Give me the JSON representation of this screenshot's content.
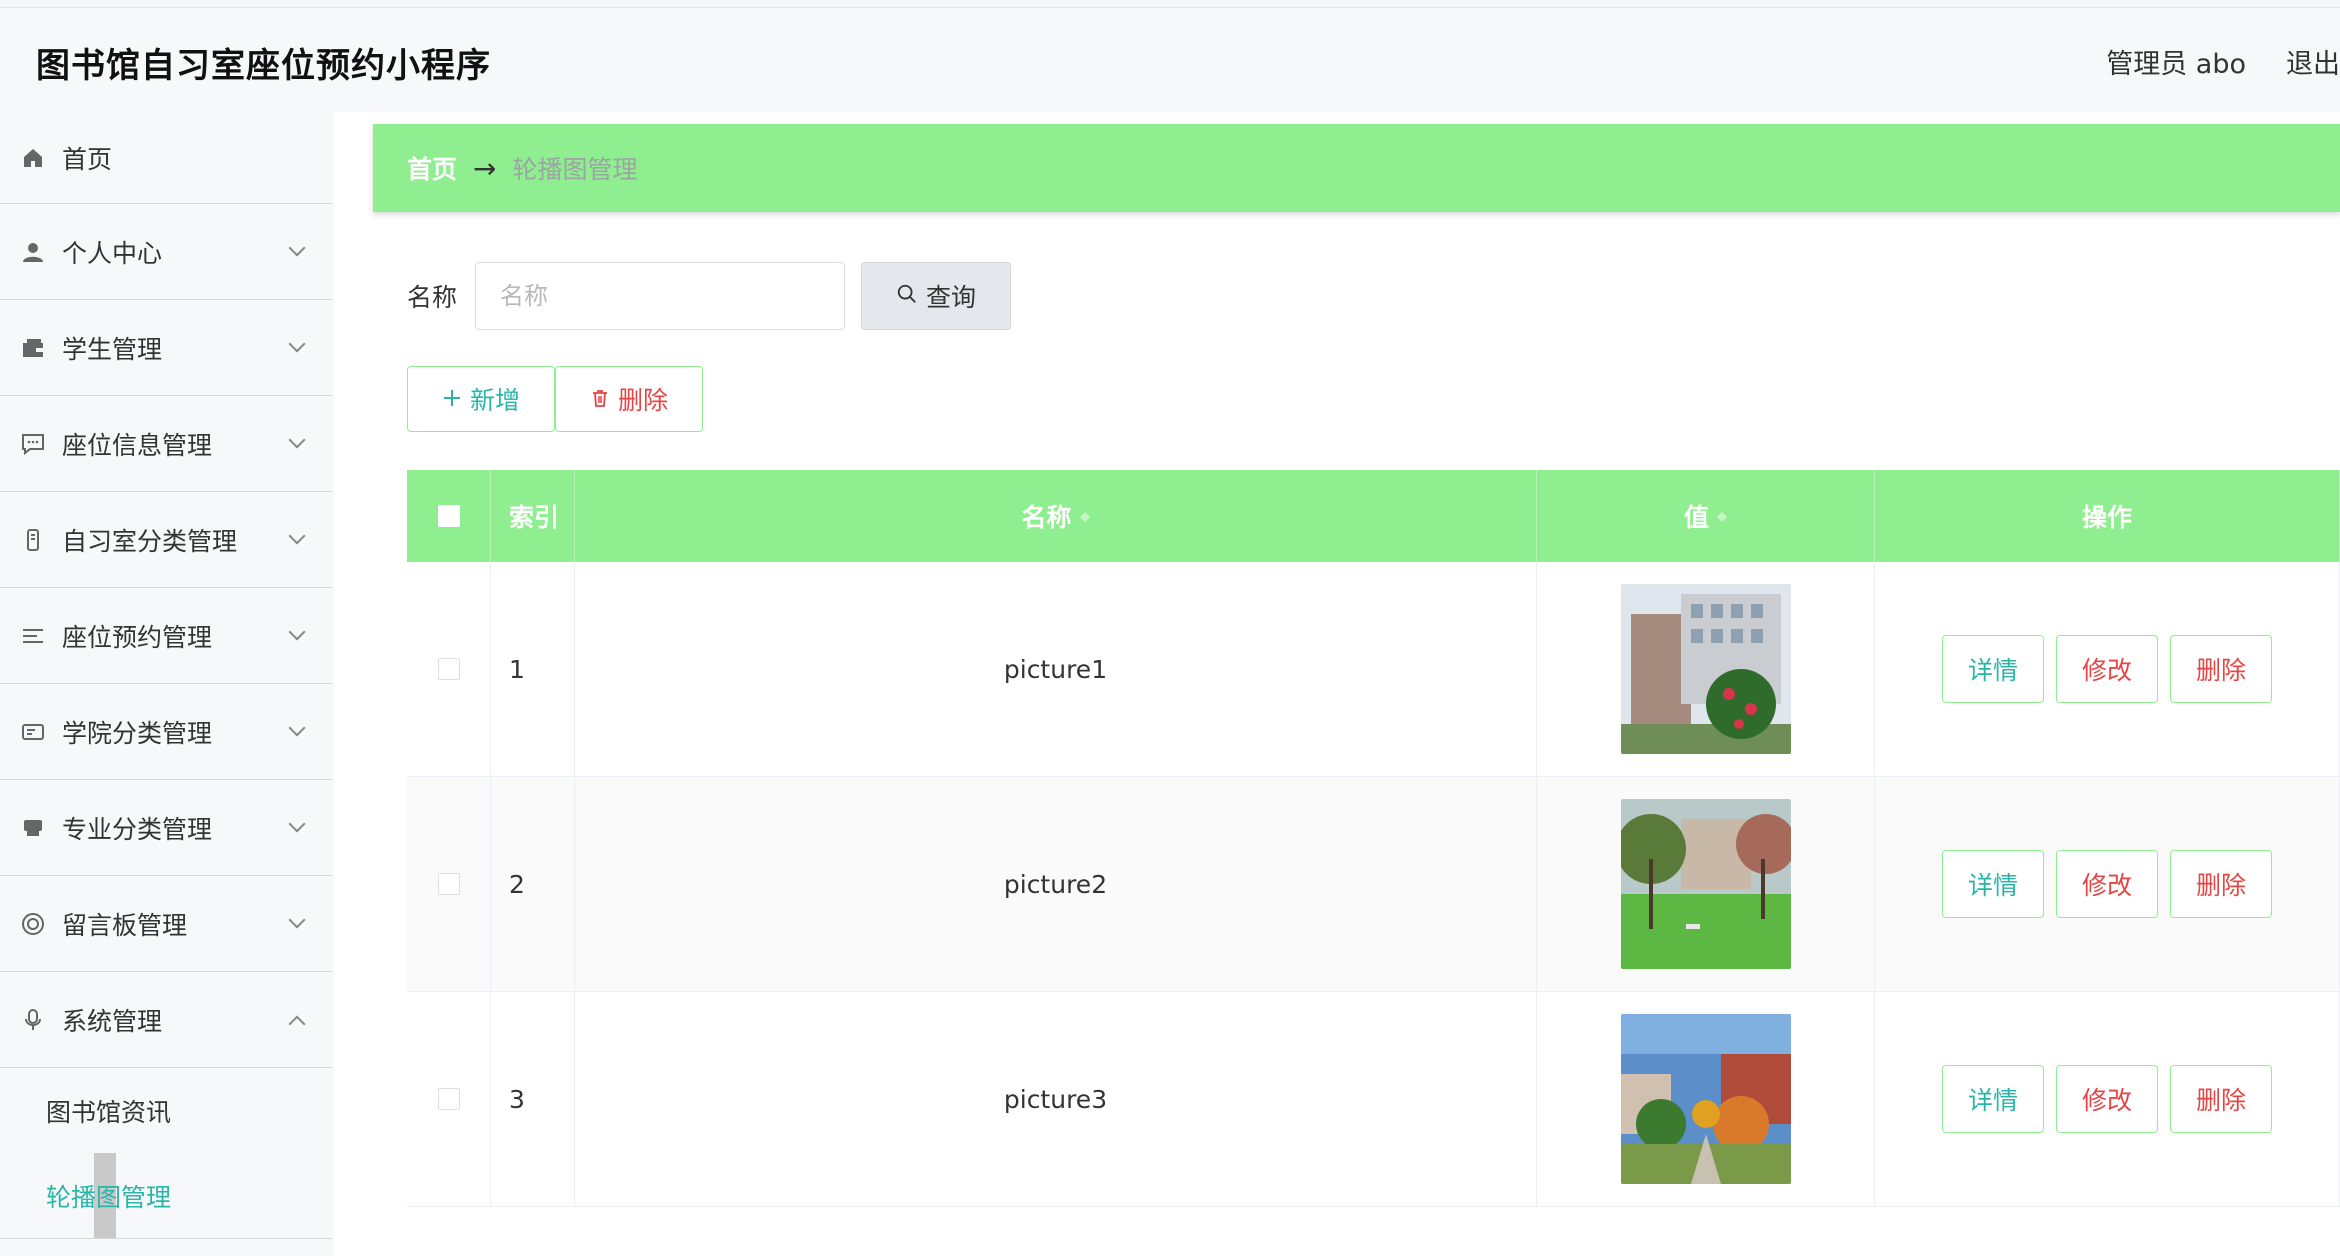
{
  "app": {
    "title": "图书馆自习室座位预约小程序"
  },
  "header": {
    "user_label": "管理员 abo",
    "logout_label": "退出"
  },
  "sidebar": {
    "items": [
      {
        "label": "首页",
        "icon": "home-icon"
      },
      {
        "label": "个人中心",
        "icon": "user-icon"
      },
      {
        "label": "学生管理",
        "icon": "wallet-icon"
      },
      {
        "label": "座位信息管理",
        "icon": "chat-icon"
      },
      {
        "label": "自习室分类管理",
        "icon": "phone-icon"
      },
      {
        "label": "座位预约管理",
        "icon": "list-icon"
      },
      {
        "label": "学院分类管理",
        "icon": "card-icon"
      },
      {
        "label": "专业分类管理",
        "icon": "shop-icon"
      },
      {
        "label": "留言板管理",
        "icon": "help-icon"
      },
      {
        "label": "系统管理",
        "icon": "mic-icon"
      }
    ],
    "sub_items": [
      {
        "label": "图书馆资讯"
      },
      {
        "label": "轮播图管理"
      }
    ]
  },
  "breadcrumb": {
    "home": "首页",
    "separator": "→",
    "current": "轮播图管理"
  },
  "search": {
    "label": "名称",
    "placeholder": "名称",
    "value": "",
    "button_label": "查询"
  },
  "toolbar": {
    "add_label": "新增",
    "delete_label": "删除"
  },
  "table": {
    "headers": {
      "index": "索引",
      "name": "名称",
      "value": "值",
      "ops": "操作"
    },
    "rows": [
      {
        "index": "1",
        "name": "picture1"
      },
      {
        "index": "2",
        "name": "picture2"
      },
      {
        "index": "3",
        "name": "picture3"
      }
    ],
    "op_labels": {
      "detail": "详情",
      "edit": "修改",
      "remove": "删除"
    }
  },
  "colors": {
    "accent_green": "#8fee8f",
    "teal": "#2bb5a8",
    "danger": "#e64545"
  }
}
